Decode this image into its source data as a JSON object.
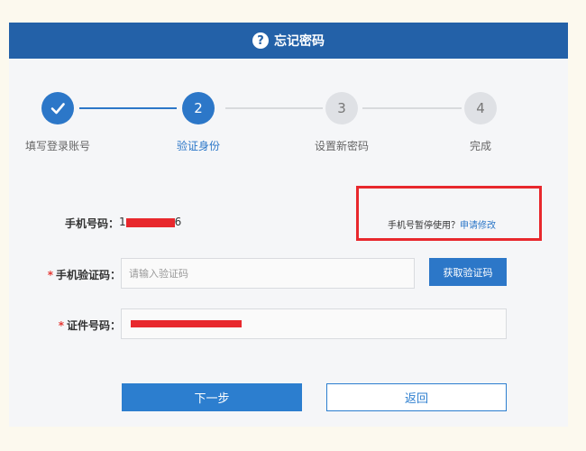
{
  "header": {
    "title": "忘记密码",
    "help_glyph": "?"
  },
  "steps": [
    {
      "number": "1",
      "label": "填写登录账号",
      "state": "done"
    },
    {
      "number": "2",
      "label": "验证身份",
      "state": "active"
    },
    {
      "number": "3",
      "label": "设置新密码",
      "state": "pending"
    },
    {
      "number": "4",
      "label": "完成",
      "state": "pending"
    }
  ],
  "form": {
    "phone_label": "手机号码：",
    "phone_prefix": "1",
    "phone_suffix": "6",
    "code_label": "手机验证码：",
    "code_placeholder": "请输入验证码",
    "get_code_label": "获取验证码",
    "id_label": "证件号码：",
    "required_mark": "*",
    "notice_text": "手机号暂停使用？",
    "notice_link": "申请修改"
  },
  "actions": {
    "next_label": "下一步",
    "back_label": "返回"
  },
  "colors": {
    "brand": "#2361a8",
    "accent": "#2c77c8",
    "redact": "#e8282d"
  }
}
